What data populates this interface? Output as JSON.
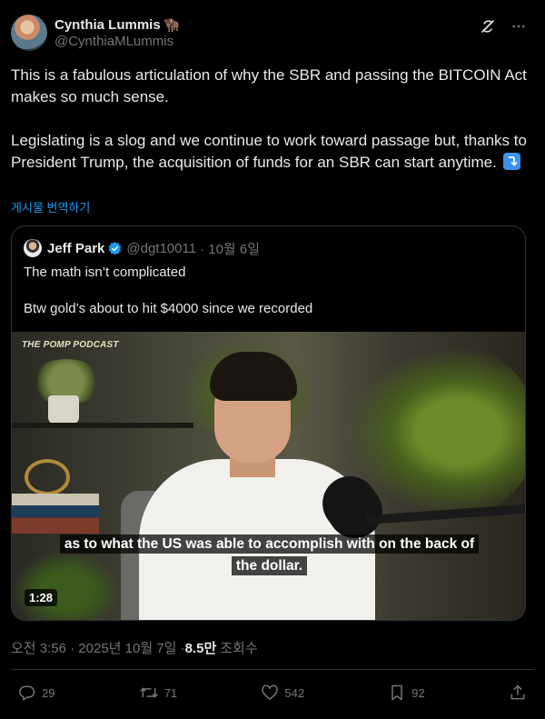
{
  "author": {
    "display_name": "Cynthia Lummis",
    "name_emoji": "🦬",
    "handle": "@CynthiaMLummis"
  },
  "tweet": {
    "paragraph1": "This is a fabulous articulation of why the SBR and passing the BITCOIN Act makes so much sense.",
    "paragraph2": "Legislating is a slog and we continue to work toward passage but, thanks to President Trump, the acquisition of funds for an SBR can start anytime.",
    "translate_label": "게시물 번역하기"
  },
  "quote": {
    "name": "Jeff Park",
    "handle": "@dgt10011",
    "date": "· 10월 6일",
    "line1": "The math isn’t complicated",
    "line2": "Btw gold’s about to hit $4000 since we recorded",
    "video": {
      "podcast_logo": "THE POMP PODCAST",
      "caption_line1": "as to what the US was able to accomplish with on the back of",
      "caption_line2": "the dollar.",
      "duration": "1:28"
    }
  },
  "meta": {
    "timestamp": "오전 3:56 · 2025년 10월 7일 · ",
    "views_count": "8.5만",
    "views_label": "조회수"
  },
  "stats": {
    "replies": "29",
    "reposts": "71",
    "likes": "542",
    "bookmarks": "92"
  },
  "colors": {
    "background": "#000000",
    "text": "#e7e9ea",
    "muted": "#71767b",
    "accent": "#1d9bf0",
    "border": "#2f3336"
  },
  "icons": [
    "grok-icon",
    "more-icon",
    "verified-icon",
    "reply-icon",
    "repost-icon",
    "like-icon",
    "bookmark-icon",
    "share-icon"
  ]
}
